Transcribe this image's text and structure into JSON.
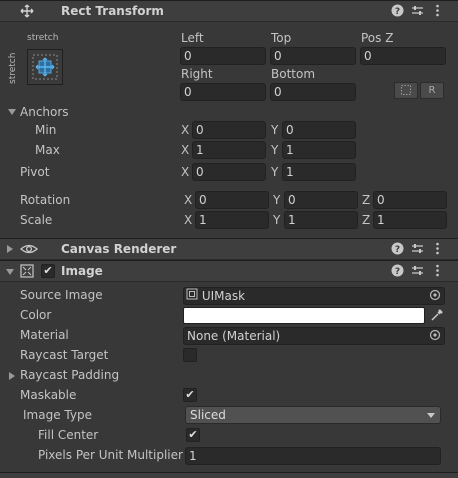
{
  "rect_transform": {
    "title": "Rect Transform",
    "anchor_preset_top": "stretch",
    "anchor_preset_side": "stretch",
    "left_label": "Left",
    "left_value": "0",
    "top_label": "Top",
    "top_value": "0",
    "posz_label": "Pos Z",
    "posz_value": "0",
    "right_label": "Right",
    "right_value": "0",
    "bottom_label": "Bottom",
    "bottom_value": "0",
    "raw_button": "R",
    "anchors_label": "Anchors",
    "min_label": "Min",
    "min_x": "0",
    "min_y": "0",
    "max_label": "Max",
    "max_x": "1",
    "max_y": "1",
    "pivot_label": "Pivot",
    "pivot_x": "0",
    "pivot_y": "1",
    "rotation_label": "Rotation",
    "rot_x": "0",
    "rot_y": "0",
    "rot_z": "0",
    "scale_label": "Scale",
    "scale_x": "1",
    "scale_y": "1",
    "scale_z": "1",
    "x": "X",
    "y": "Y",
    "z": "Z"
  },
  "canvas_renderer": {
    "title": "Canvas Renderer"
  },
  "image": {
    "title": "Image",
    "source_image_label": "Source Image",
    "source_image_value": "UIMask",
    "color_label": "Color",
    "color_value": "#ffffff",
    "material_label": "Material",
    "material_value": "None (Material)",
    "raycast_target_label": "Raycast Target",
    "raycast_padding_label": "Raycast Padding",
    "maskable_label": "Maskable",
    "image_type_label": "Image Type",
    "image_type_value": "Sliced",
    "fill_center_label": "Fill Center",
    "ppu_label": "Pixels Per Unit Multiplier",
    "ppu_value": "1"
  }
}
